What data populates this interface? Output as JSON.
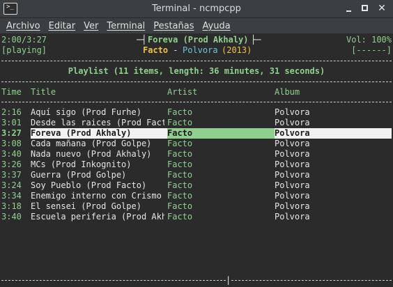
{
  "window": {
    "title": "Terminal - ncmpcpp",
    "app_icon": "terminal-prompt-icon",
    "controls": {
      "minimize": "minimize-icon",
      "maximize": "maximize-icon",
      "close": "close-icon"
    }
  },
  "menubar": {
    "items": [
      "Archivo",
      "Editar",
      "Ver",
      "Terminal",
      "Pestañas",
      "Ayuda"
    ]
  },
  "player": {
    "elapsed": "2:00/3:27",
    "state": "[playing]",
    "now_playing_title": "Foreva (Prod Akhaly)",
    "now_playing_artist": "Facto",
    "separator": " - ",
    "now_playing_album": "Polvora",
    "now_playing_year": "(2013)",
    "volume": "Vol: 100%",
    "modes": "[------]",
    "bracket_left": "─┤",
    "bracket_right": "├─"
  },
  "playlist": {
    "header": "Playlist (11 items, length: 36 minutes, 31 seconds)",
    "columns": {
      "time": "Time",
      "title": "Title",
      "artist": "Artist",
      "album": "Album"
    },
    "selected_index": 2,
    "rows": [
      {
        "time": "2:16",
        "title": "Aquí sigo (Prod Furhe)",
        "artist": "Facto",
        "album": "Polvora"
      },
      {
        "time": "3:01",
        "title": "Desde las raices (Prod Fact",
        "artist": "Facto",
        "album": "Polvora"
      },
      {
        "time": "3:27",
        "title": "Foreva (Prod Akhaly)",
        "artist": "Facto",
        "album": "Polvora"
      },
      {
        "time": "3:08",
        "title": "Cada mañana (Prod Golpe)",
        "artist": "Facto",
        "album": "Polvora"
      },
      {
        "time": "3:40",
        "title": "Nada nuevo (Prod Akhaly)",
        "artist": "Facto",
        "album": "Polvora"
      },
      {
        "time": "3:26",
        "title": "MCs (Prod Inkognito)",
        "artist": "Facto",
        "album": "Polvora"
      },
      {
        "time": "3:37",
        "title": "Guerra (Prod Golpe)",
        "artist": "Facto",
        "album": "Polvora"
      },
      {
        "time": "3:24",
        "title": "Soy Pueblo (Prod Facto)",
        "artist": "Facto",
        "album": "Polvora"
      },
      {
        "time": "3:34",
        "title": "Enemigo interno con Crismo",
        "artist": "Facto",
        "album": "Polvora"
      },
      {
        "time": "3:18",
        "title": "El sensei (Prod Golpe)",
        "artist": "Facto",
        "album": "Polvora"
      },
      {
        "time": "3:40",
        "title": "Escuela periferia (Prod Akh",
        "artist": "Facto",
        "album": "Polvora"
      }
    ]
  },
  "progress": {
    "fraction": 0.58
  },
  "colors": {
    "accent_green": "#8fd08f",
    "accent_yellow": "#f0c040",
    "accent_cyan": "#6ec6d6",
    "background": "#2b2b2b"
  }
}
